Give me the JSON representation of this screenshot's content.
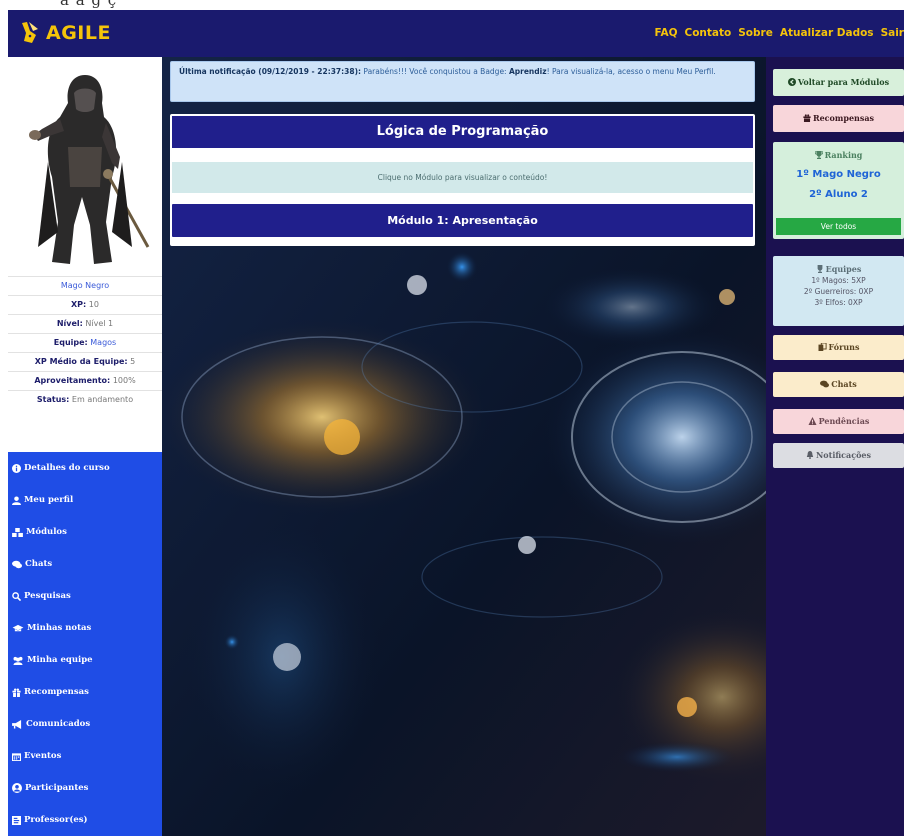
{
  "brand": {
    "name": "AGILE",
    "accent": "#f5c40a",
    "navbar_color": "#1a1a6e"
  },
  "topnav": [
    "FAQ",
    "Contato",
    "Sobre",
    "Atualizar Dados",
    "Sair"
  ],
  "notification": {
    "label": "Última notificação (09/12/2019 - 22:37:38):",
    "text_before": " Parabéns!!! Você conquistou a Badge: ",
    "badge": "Aprendiz",
    "text_after": "! Para visualizá-la, acesso o menu Meu Perfil."
  },
  "course": {
    "title": "Lógica de Programação",
    "hint": "Clique no Módulo para visualizar o conteúdo!",
    "module": "Módulo 1: Apresentação"
  },
  "profile": {
    "name": "Mago Negro",
    "stats": [
      {
        "label": "XP:",
        "value": "10"
      },
      {
        "label": "Nível:",
        "value": "Nível 1"
      },
      {
        "label": "Equipe:",
        "value": "Magos"
      },
      {
        "label": "XP Médio da Equipe:",
        "value": "5"
      },
      {
        "label": "Aproveitamento:",
        "value": "100%"
      },
      {
        "label": "Status:",
        "value": "Em andamento"
      }
    ]
  },
  "sidebar": {
    "items": [
      {
        "label": "Detalhes do curso",
        "icon": "info-icon"
      },
      {
        "label": "Meu perfil",
        "icon": "user-icon"
      },
      {
        "label": "Módulos",
        "icon": "cubes-icon"
      },
      {
        "label": "Chats",
        "icon": "comments-icon"
      },
      {
        "label": "Pesquisas",
        "icon": "search-icon"
      },
      {
        "label": "Minhas notas",
        "icon": "graduation-cap-icon"
      },
      {
        "label": "Minha equipe",
        "icon": "users-icon"
      },
      {
        "label": "Recompensas",
        "icon": "gift-icon"
      },
      {
        "label": "Comunicados",
        "icon": "bullhorn-icon"
      },
      {
        "label": "Eventos",
        "icon": "calendar-icon"
      },
      {
        "label": "Participantes",
        "icon": "user-circle-icon"
      },
      {
        "label": "Professor(es)",
        "icon": "id-card-icon"
      }
    ],
    "color": "#1f4de6"
  },
  "right": {
    "back": "Voltar para Módulos",
    "rewards": "Recompensas",
    "ranking": {
      "title": "Ranking",
      "items": [
        "1º Mago Negro",
        "2º Aluno 2"
      ],
      "view_all": "Ver todos"
    },
    "teams": {
      "title": "Equipes",
      "items": [
        "1º Magos: 5XP",
        "2º Guerreiros: 0XP",
        "3º Elfos: 0XP"
      ]
    },
    "forums": "Fóruns",
    "chats": "Chats",
    "pending": "Pendências",
    "notifications": "Notificações"
  }
}
